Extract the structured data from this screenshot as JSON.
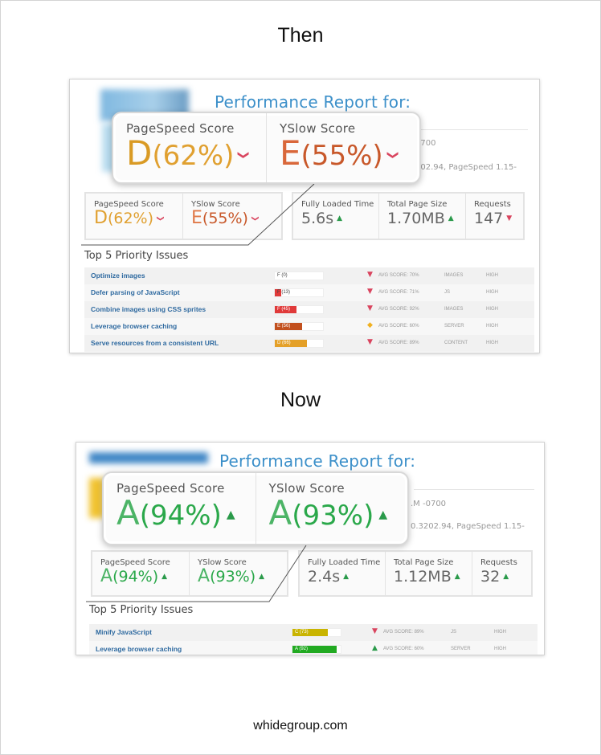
{
  "colors": {
    "title_blue": "#3b8fc9",
    "grade_D": "#e0a030",
    "grade_E": "#c8582a",
    "grade_A": "#2aa84a",
    "down_arrow": "#d9445e",
    "up_arrow": "#2a9a4a",
    "issue_link": "#2f6aa0"
  },
  "then": {
    "heading": "Then",
    "report": {
      "title": "Performance Report for:",
      "meta_line1": "0700",
      "meta_line2": "202.94, PageSpeed 1.15-",
      "callout": {
        "pagespeed": {
          "label": "PageSpeed Score",
          "grade": "D",
          "percent": "(62%)",
          "trend": "down"
        },
        "yslow": {
          "label": "YSlow Score",
          "grade": "E",
          "percent": "(55%)",
          "trend": "down"
        }
      },
      "scores": {
        "pagespeed": {
          "label": "PageSpeed Score",
          "grade": "D",
          "percent": "(62%)",
          "trend": "down"
        },
        "yslow": {
          "label": "YSlow Score",
          "grade": "E",
          "percent": "(55%)",
          "trend": "down"
        }
      },
      "details": {
        "loaded": {
          "label": "Fully Loaded Time",
          "value": "5.6s",
          "trend": "up"
        },
        "size": {
          "label": "Total Page Size",
          "value": "1.70MB",
          "trend": "up"
        },
        "requests": {
          "label": "Requests",
          "value": "147",
          "trend": "down"
        }
      },
      "issues_title": "Top 5 Priority Issues",
      "issues": [
        {
          "name": "Optimize images",
          "grade_label": "F (0)",
          "score": 0,
          "bar_color": "#e03a3a",
          "trend": "down",
          "avg": "AVG SCORE: 70%",
          "type": "IMAGES",
          "priority": "HIGH"
        },
        {
          "name": "Defer parsing of JavaScript",
          "grade_label": "F (13)",
          "score": 13,
          "bar_color": "#e03a3a",
          "trend": "down",
          "avg": "AVG SCORE: 71%",
          "type": "JS",
          "priority": "HIGH"
        },
        {
          "name": "Combine images using CSS sprites",
          "grade_label": "F (45)",
          "score": 45,
          "bar_color": "#e03a3a",
          "trend": "down",
          "avg": "AVG SCORE: 92%",
          "type": "IMAGES",
          "priority": "HIGH"
        },
        {
          "name": "Leverage browser caching",
          "grade_label": "E (56)",
          "score": 56,
          "bar_color": "#c2501e",
          "trend": "neutral",
          "avg": "AVG SCORE: 60%",
          "type": "SERVER",
          "priority": "HIGH"
        },
        {
          "name": "Serve resources from a consistent URL",
          "grade_label": "D (66)",
          "score": 66,
          "bar_color": "#e4a028",
          "trend": "down",
          "avg": "AVG SCORE: 89%",
          "type": "CONTENT",
          "priority": "HIGH"
        }
      ]
    }
  },
  "now": {
    "heading": "Now",
    "report": {
      "title": "Performance Report for:",
      "meta_line1": ".M -0700",
      "meta_line2": "0.3202.94, PageSpeed 1.15-",
      "callout": {
        "pagespeed": {
          "label": "PageSpeed Score",
          "grade": "A",
          "percent": "(94%)",
          "trend": "up"
        },
        "yslow": {
          "label": "YSlow Score",
          "grade": "A",
          "percent": "(93%)",
          "trend": "up"
        }
      },
      "scores": {
        "pagespeed": {
          "label": "PageSpeed Score",
          "grade": "A",
          "percent": "(94%)",
          "trend": "up"
        },
        "yslow": {
          "label": "YSlow Score",
          "grade": "A",
          "percent": "(93%)",
          "trend": "up"
        }
      },
      "details": {
        "loaded": {
          "label": "Fully Loaded Time",
          "value": "2.4s",
          "trend": "up"
        },
        "size": {
          "label": "Total Page Size",
          "value": "1.12MB",
          "trend": "up"
        },
        "requests": {
          "label": "Requests",
          "value": "32",
          "trend": "up"
        }
      },
      "issues_title": "Top 5 Priority Issues",
      "issues": [
        {
          "name": "Minify JavaScript",
          "grade_label": "C (73)",
          "score": 73,
          "bar_color": "#c9b400",
          "trend": "down",
          "avg": "AVG SCORE: 89%",
          "type": "JS",
          "priority": "HIGH"
        },
        {
          "name": "Leverage browser caching",
          "grade_label": "A (92)",
          "score": 92,
          "bar_color": "#22aa22",
          "trend": "up",
          "avg": "AVG SCORE: 60%",
          "type": "SERVER",
          "priority": "HIGH"
        }
      ]
    }
  },
  "footer": "whidegroup.com"
}
